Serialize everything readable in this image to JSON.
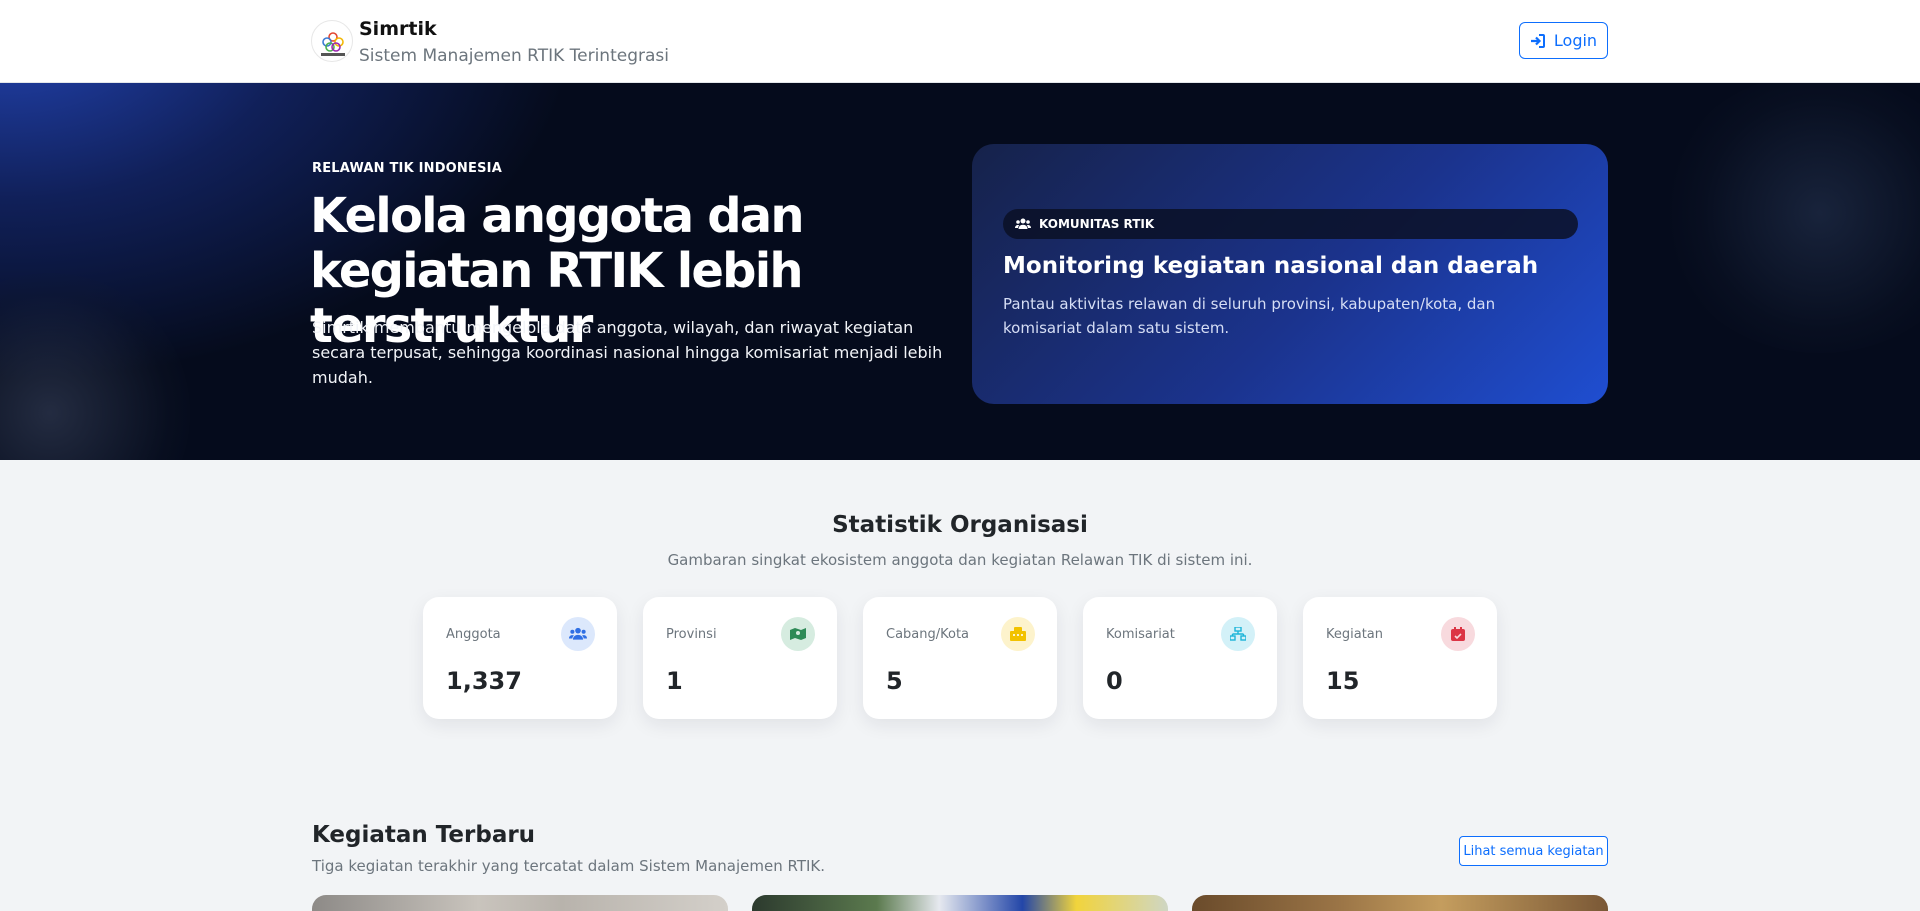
{
  "header": {
    "brand_name": "Simrtik",
    "brand_subtitle": "Sistem Manajemen RTIK Terintegrasi",
    "login_label": "Login"
  },
  "hero": {
    "eyebrow": "RELAWAN TIK INDONESIA",
    "title": "Kelola anggota dan kegiatan RTIK lebih terstruktur",
    "description": "Simrtik membantu mengelola data anggota, wilayah, dan riwayat kegiatan secara terpusat, sehingga koordinasi nasional hingga komisariat menjadi lebih mudah.",
    "card": {
      "badge": "KOMUNITAS RTIK",
      "title": "Monitoring kegiatan nasional dan daerah",
      "description": "Pantau aktivitas relawan di seluruh provinsi, kabupaten/kota, dan komisariat dalam satu sistem."
    }
  },
  "stats": {
    "title": "Statistik Organisasi",
    "subtitle": "Gambaran singkat ekosistem anggota dan kegiatan Relawan TIK di sistem ini.",
    "items": [
      {
        "label": "Anggota",
        "value": "1,337",
        "icon": "users-icon",
        "color": "#2f6fe4"
      },
      {
        "label": "Provinsi",
        "value": "1",
        "icon": "map-icon",
        "color": "#2e8b57"
      },
      {
        "label": "Cabang/Kota",
        "value": "5",
        "icon": "building-icon",
        "color": "#f2c200"
      },
      {
        "label": "Komisariat",
        "value": "0",
        "icon": "sitemap-icon",
        "color": "#1cb5d8"
      },
      {
        "label": "Kegiatan",
        "value": "15",
        "icon": "calendar-icon",
        "color": "#dc3545"
      }
    ]
  },
  "recent": {
    "title": "Kegiatan Terbaru",
    "subtitle": "Tiga kegiatan terakhir yang tercatat dalam Sistem Manajemen RTIK.",
    "see_all_label": "Lihat semua kegiatan"
  }
}
